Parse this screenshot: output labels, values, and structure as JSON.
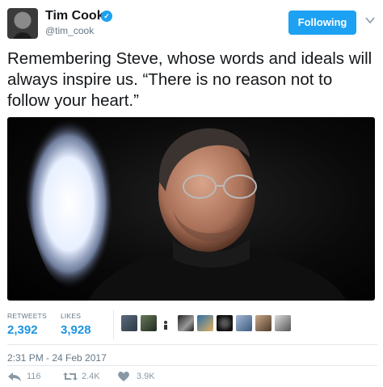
{
  "user": {
    "name": "Tim Cook",
    "handle": "@tim_cook",
    "follow_label": "Following"
  },
  "tweet": {
    "text": "Remembering Steve, whose words and ideals will always inspire us. “There is no reason not to follow your heart.”",
    "timestamp": "2:31 PM - 24 Feb 2017"
  },
  "stats": {
    "retweets_label": "RETWEETS",
    "retweets_value": "2,392",
    "likes_label": "LIKES",
    "likes_value": "3,928"
  },
  "actions": {
    "reply_count": "116",
    "retweet_count": "2.4K",
    "like_count": "3.9K"
  },
  "colors": {
    "accent": "#1da1f2",
    "link": "#1b95e0",
    "muted": "#657786"
  },
  "icons": [
    "verified-icon",
    "chevron-down-icon",
    "reply-icon",
    "retweet-icon",
    "heart-icon"
  ]
}
